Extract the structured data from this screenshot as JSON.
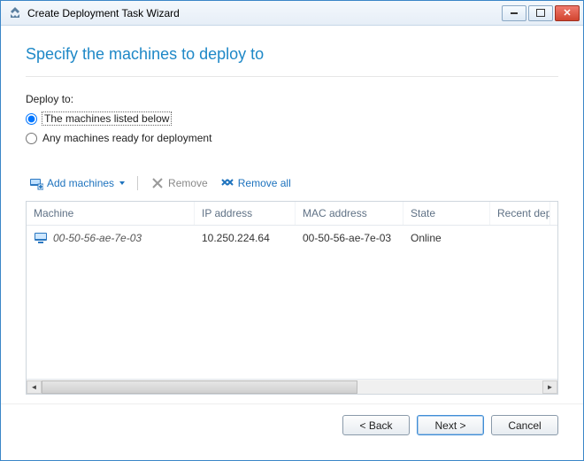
{
  "window": {
    "title": "Create Deployment Task Wizard"
  },
  "heading": "Specify the machines to deploy to",
  "deploy_to_label": "Deploy to:",
  "radio": {
    "listed": "The machines listed below",
    "any": "Any machines ready for deployment"
  },
  "toolbar": {
    "add": "Add machines",
    "remove": "Remove",
    "remove_all": "Remove all"
  },
  "grid": {
    "columns": {
      "machine": "Machine",
      "ip": "IP address",
      "mac": "MAC address",
      "state": "State",
      "recent": "Recent dep"
    },
    "rows": [
      {
        "machine": "00-50-56-ae-7e-03",
        "ip": "10.250.224.64",
        "mac": "00-50-56-ae-7e-03",
        "state": "Online",
        "recent": ""
      }
    ]
  },
  "footer": {
    "back": "< Back",
    "next": "Next >",
    "cancel": "Cancel"
  }
}
